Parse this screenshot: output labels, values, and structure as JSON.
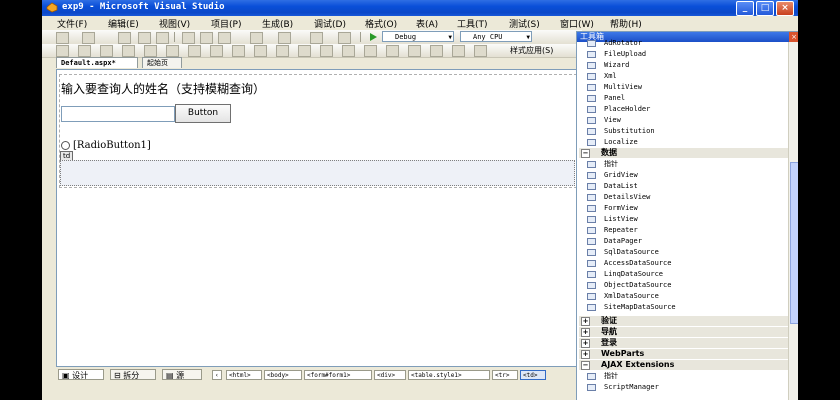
{
  "window": {
    "title": "exp9 - Microsoft Visual Studio"
  },
  "menu": [
    "文件(F)",
    "编辑(E)",
    "视图(V)",
    "项目(P)",
    "生成(B)",
    "调试(D)",
    "格式(O)",
    "表(A)",
    "工具(T)",
    "测试(S)",
    "窗口(W)",
    "帮助(H)"
  ],
  "toolbar": {
    "config": "Debug",
    "platform": "Any CPU",
    "style_app": "样式应用(S)"
  },
  "doc_tabs": [
    {
      "label": "Default.aspx*",
      "active": true
    },
    {
      "label": "起始页",
      "active": false
    }
  ],
  "designer": {
    "prompt": "输入要查询人的姓名（支持模糊查询）",
    "button_label": "Button",
    "radio_label": "[RadioButton1]",
    "td_tag": "td"
  },
  "view_tabs": [
    {
      "label": "设计",
      "icon": "design-view-icon",
      "active": true
    },
    {
      "label": "拆分",
      "icon": "split-view-icon",
      "active": false
    },
    {
      "label": "源",
      "icon": "source-view-icon",
      "active": false
    }
  ],
  "breadcrumbs": [
    "<html>",
    "<body>",
    "<form#form1>",
    "<div>",
    "<table.style1>",
    "<tr>",
    "<td>"
  ],
  "toolbox": {
    "title": "工具箱",
    "items_top": [
      "AdRotator",
      "FileUpload",
      "Wizard",
      "Xml",
      "MultiView",
      "Panel",
      "PlaceHolder",
      "View",
      "Substitution",
      "Localize"
    ],
    "data_category": "数据",
    "data_items": [
      "指针",
      "GridView",
      "DataList",
      "DetailsView",
      "FormView",
      "ListView",
      "Repeater",
      "DataPager",
      "SqlDataSource",
      "AccessDataSource",
      "LinqDataSource",
      "ObjectDataSource",
      "XmlDataSource",
      "SiteMapDataSource"
    ],
    "collapsed_categories": [
      "验证",
      "导航",
      "登录",
      "WebParts"
    ],
    "ajax_category": "AJAX Extensions",
    "ajax_items": [
      "指针",
      "ScriptManager"
    ]
  },
  "colors": {
    "titlebar": "#0b48c8",
    "chrome": "#ece9d8",
    "accent": "#316ac5"
  }
}
